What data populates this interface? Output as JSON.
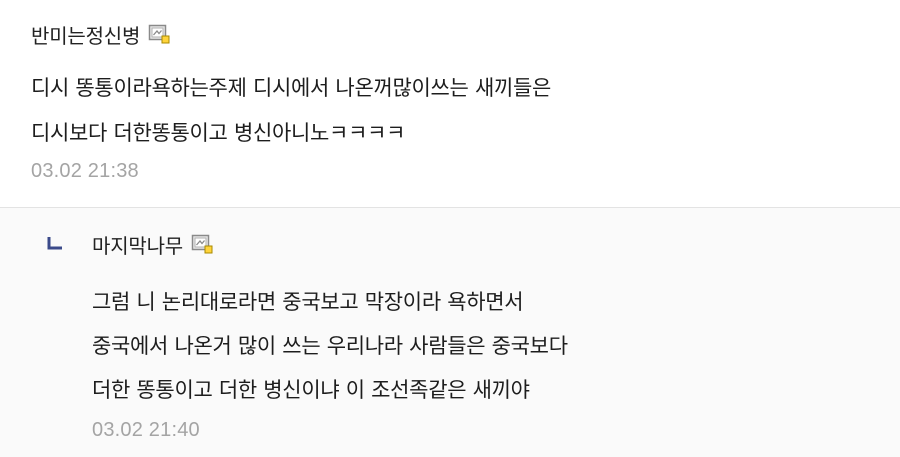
{
  "comment": {
    "nickname": "반미는정신병",
    "lines": [
      "디시 똥통이라욕하는주제 디시에서 나온꺼많이쓰는 새끼들은",
      "디시보다 더한똥통이고 병신아니노ㅋㅋㅋㅋ"
    ],
    "date": "03.02 21:38"
  },
  "reply": {
    "nickname": "마지막나무",
    "lines": [
      "그럼 니 논리대로라면 중국보고 막장이라 욕하면서",
      "중국에서 나온거 많이 쓰는 우리나라 사람들은 중국보다",
      "더한 똥통이고 더한 병신이냐 이 조선족같은 새끼야"
    ],
    "date": "03.02 21:40"
  },
  "icons": {
    "gallog": "gallog-icon",
    "reply_marker": "reply-arrow-icon"
  },
  "colors": {
    "date": "#a4a4a4",
    "reply_background": "#fafafa",
    "reply_arrow": "#3b4a8a",
    "divider": "#e3e3e3"
  }
}
